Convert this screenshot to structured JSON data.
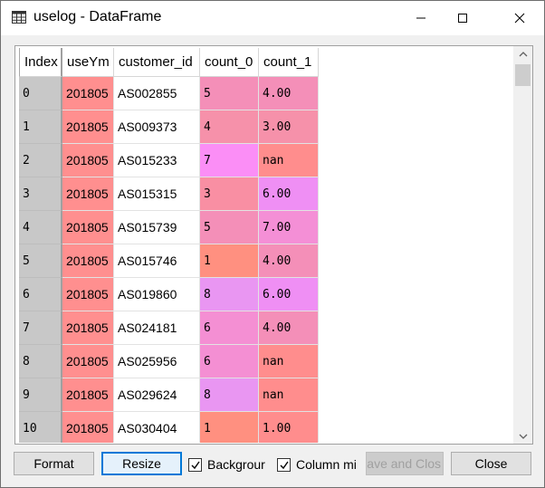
{
  "window": {
    "title": "uselog - DataFrame",
    "icon": "table-grid-icon"
  },
  "table": {
    "columns": [
      "Index",
      "useYm",
      "customer_id",
      "count_0",
      "count_1"
    ],
    "rows": [
      {
        "index": "0",
        "useYm": "201805",
        "customer_id": "AS002855",
        "count_0": "5",
        "count_1": "4.00",
        "c0_color": "#f48fb8",
        "c1_color": "#f48fb8"
      },
      {
        "index": "1",
        "useYm": "201805",
        "customer_id": "AS009373",
        "count_0": "4",
        "count_1": "3.00",
        "c0_color": "#f691aa",
        "c1_color": "#f691aa"
      },
      {
        "index": "2",
        "useYm": "201805",
        "customer_id": "AS015233",
        "count_0": "7",
        "count_1": "nan",
        "c0_color": "#fb8ef6",
        "c1_color": "#ff8d8d"
      },
      {
        "index": "3",
        "useYm": "201805",
        "customer_id": "AS015315",
        "count_0": "3",
        "count_1": "6.00",
        "c0_color": "#f98fa3",
        "c1_color": "#ef8ff4"
      },
      {
        "index": "4",
        "useYm": "201805",
        "customer_id": "AS015739",
        "count_0": "5",
        "count_1": "7.00",
        "c0_color": "#f48fb8",
        "c1_color": "#f48fd6"
      },
      {
        "index": "5",
        "useYm": "201805",
        "customer_id": "AS015746",
        "count_0": "1",
        "count_1": "4.00",
        "c0_color": "#ff9080",
        "c1_color": "#f48fb8"
      },
      {
        "index": "6",
        "useYm": "201805",
        "customer_id": "AS019860",
        "count_0": "8",
        "count_1": "6.00",
        "c0_color": "#e996f2",
        "c1_color": "#ef8ff4"
      },
      {
        "index": "7",
        "useYm": "201805",
        "customer_id": "AS024181",
        "count_0": "6",
        "count_1": "4.00",
        "c0_color": "#f48fd3",
        "c1_color": "#f48fb8"
      },
      {
        "index": "8",
        "useYm": "201805",
        "customer_id": "AS025956",
        "count_0": "6",
        "count_1": "nan",
        "c0_color": "#f48fd3",
        "c1_color": "#ff8d8d"
      },
      {
        "index": "9",
        "useYm": "201805",
        "customer_id": "AS029624",
        "count_0": "8",
        "count_1": "nan",
        "c0_color": "#e996f2",
        "c1_color": "#ff8d8d"
      },
      {
        "index": "10",
        "useYm": "201805",
        "customer_id": "AS030404",
        "count_0": "1",
        "count_1": "1.00",
        "c0_color": "#ff9080",
        "c1_color": "#ff8d8d"
      }
    ],
    "useYm_color": "#ff8f8f"
  },
  "buttons": {
    "format": "Format",
    "resize": "Resize",
    "background": "Backgrour",
    "column_min": "Column mi",
    "save_and_close": "ave and Clos",
    "close": "Close"
  }
}
